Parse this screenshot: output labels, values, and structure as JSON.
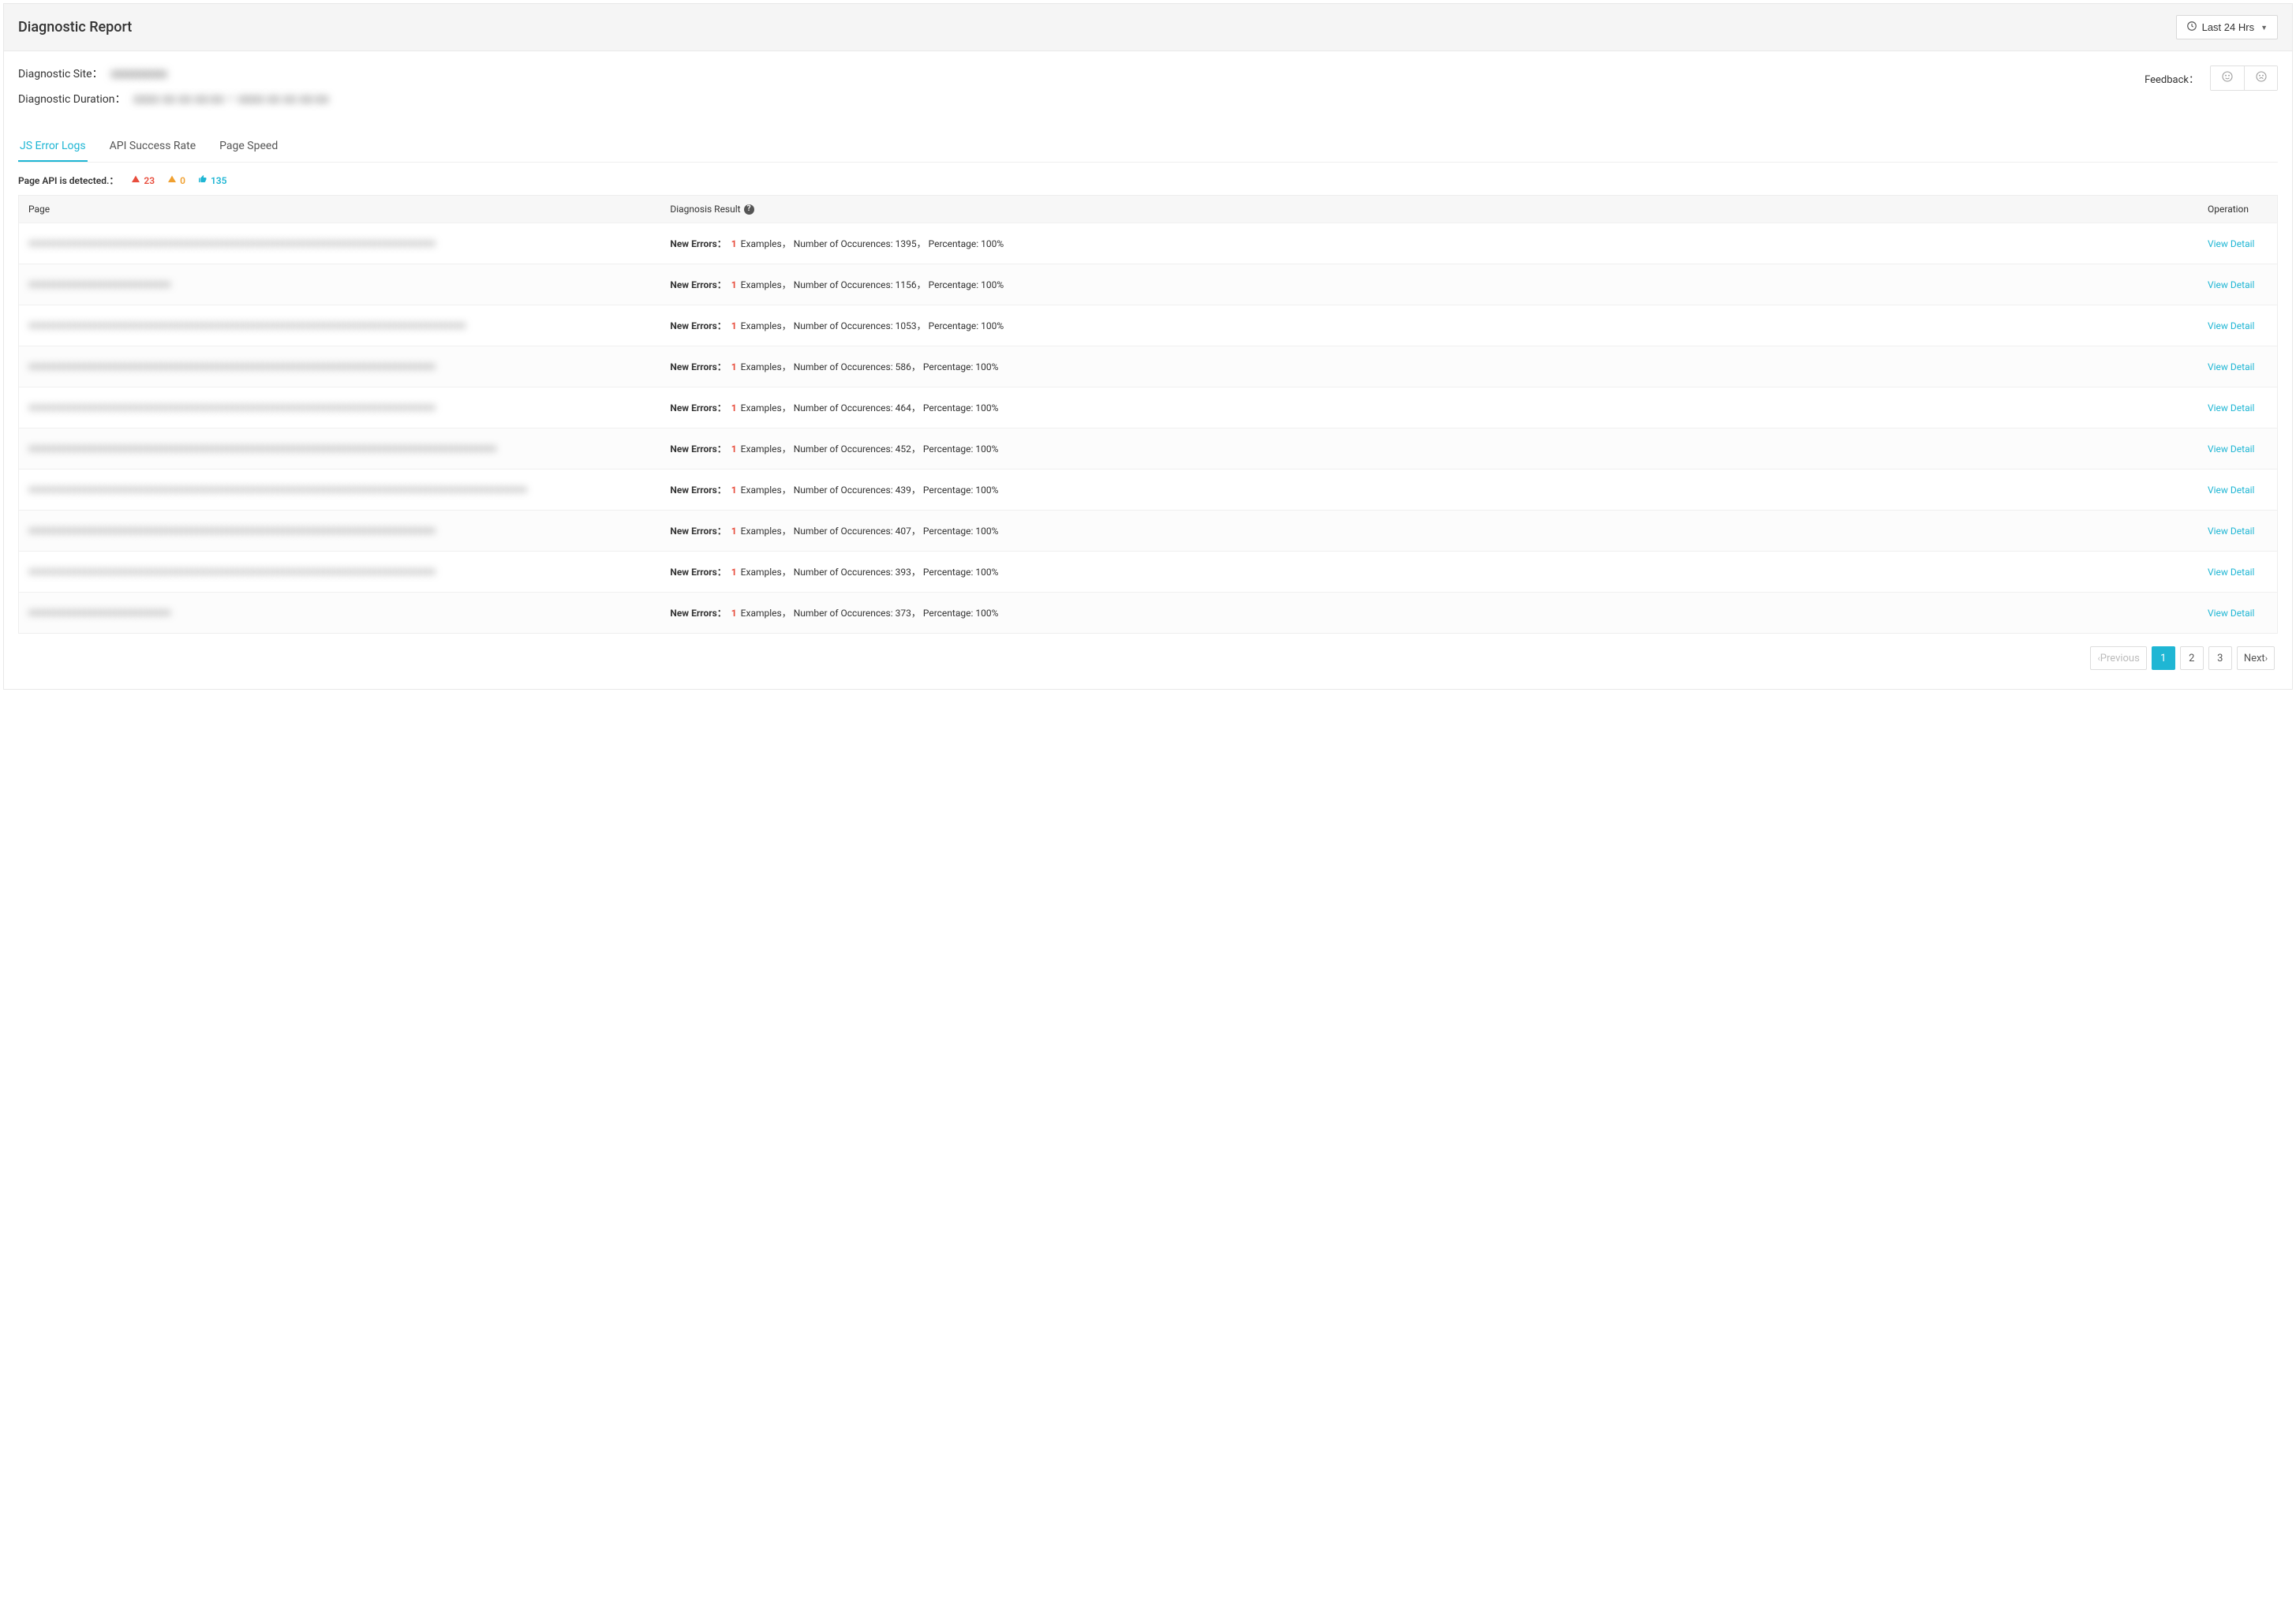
{
  "header": {
    "title": "Diagnostic Report",
    "time_range_label": "Last 24 Hrs"
  },
  "info": {
    "site_label": "Diagnostic Site：",
    "site_value": "xxxxxxxxxx",
    "duration_label": "Diagnostic Duration：",
    "duration_value": "xxxx xx xx xx:xx – xxxx xx xx xx:xx",
    "feedback_label": "Feedback："
  },
  "tabs": [
    {
      "label": "JS Error Logs",
      "active": true
    },
    {
      "label": "API Success Rate",
      "active": false
    },
    {
      "label": "Page Speed",
      "active": false
    }
  ],
  "summary": {
    "text": "Page API is detected.：",
    "critical": "23",
    "warning": "0",
    "ok": "135"
  },
  "table": {
    "headers": {
      "page": "Page",
      "result": "Diagnosis Result",
      "operation": "Operation"
    },
    "labels": {
      "new_errors": "New Errors：",
      "examples": "Examples，",
      "occurrences": "Number of Occurences:",
      "percentage": "，  Percentage:",
      "view_detail": "View Detail"
    },
    "rows": [
      {
        "examples": "1",
        "occurrences": "1395",
        "percentage": "100%",
        "page_blur": "xxxxxxxxxxxxxxxxxxxxxxxxxxxxxxxxxxxxxxxxxxxxxxxxxxxxxxxxxxxxxxxxxxxxxxxxxxxxxxxx"
      },
      {
        "examples": "1",
        "occurrences": "1156",
        "percentage": "100%",
        "page_blur": "xxxxxxxxxxxxxxxxxxxxxxxxxxxx"
      },
      {
        "examples": "1",
        "occurrences": "1053",
        "percentage": "100%",
        "page_blur": "xxxxxxxxxxxxxxxxxxxxxxxxxxxxxxxxxxxxxxxxxxxxxxxxxxxxxxxxxxxxxxxxxxxxxxxxxxxxxxxxxxxxxx"
      },
      {
        "examples": "1",
        "occurrences": "586",
        "percentage": "100%",
        "page_blur": "xxxxxxxxxxxxxxxxxxxxxxxxxxxxxxxxxxxxxxxxxxxxxxxxxxxxxxxxxxxxxxxxxxxxxxxxxxxxxxxx"
      },
      {
        "examples": "1",
        "occurrences": "464",
        "percentage": "100%",
        "page_blur": "xxxxxxxxxxxxxxxxxxxxxxxxxxxxxxxxxxxxxxxxxxxxxxxxxxxxxxxxxxxxxxxxxxxxxxxxxxxxxxxx"
      },
      {
        "examples": "1",
        "occurrences": "452",
        "percentage": "100%",
        "page_blur": "xxxxxxxxxxxxxxxxxxxxxxxxxxxxxxxxxxxxxxxxxxxxxxxxxxxxxxxxxxxxxxxxxxxxxxxxxxxxxxxxxxxxxxxxxxxx"
      },
      {
        "examples": "1",
        "occurrences": "439",
        "percentage": "100%",
        "page_blur": "xxxxxxxxxxxxxxxxxxxxxxxxxxxxxxxxxxxxxxxxxxxxxxxxxxxxxxxxxxxxxxxxxxxxxxxxxxxxxxxxxxxxxxxxxxxxxxxxxx"
      },
      {
        "examples": "1",
        "occurrences": "407",
        "percentage": "100%",
        "page_blur": "xxxxxxxxxxxxxxxxxxxxxxxxxxxxxxxxxxxxxxxxxxxxxxxxxxxxxxxxxxxxxxxxxxxxxxxxxxxxxxxx"
      },
      {
        "examples": "1",
        "occurrences": "393",
        "percentage": "100%",
        "page_blur": "xxxxxxxxxxxxxxxxxxxxxxxxxxxxxxxxxxxxxxxxxxxxxxxxxxxxxxxxxxxxxxxxxxxxxxxxxxxxxxxx"
      },
      {
        "examples": "1",
        "occurrences": "373",
        "percentage": "100%",
        "page_blur": "xxxxxxxxxxxxxxxxxxxxxxxxxxxx"
      }
    ]
  },
  "pagination": {
    "previous": "Previous",
    "pages": [
      "1",
      "2",
      "3"
    ],
    "active_index": 0,
    "next": "Next"
  }
}
